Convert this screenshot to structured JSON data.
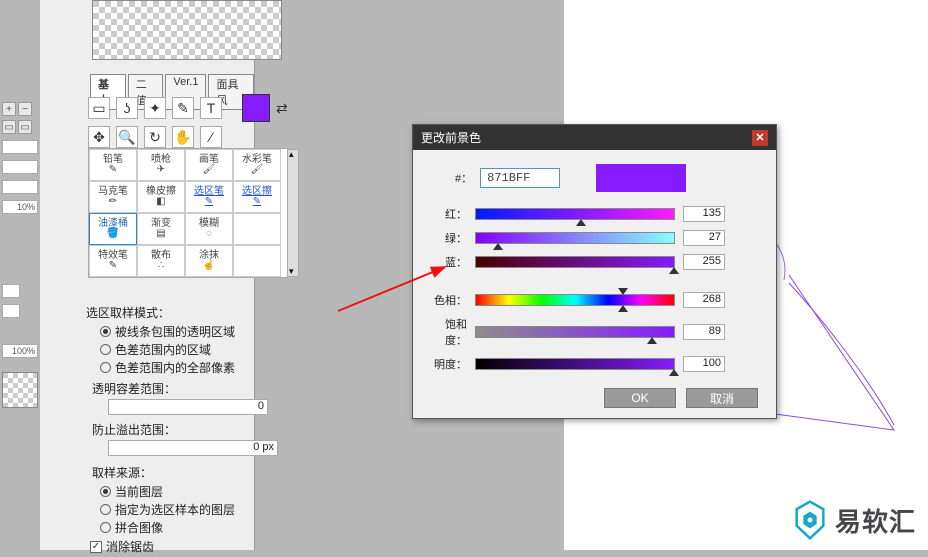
{
  "farLeft": {
    "pct": "10%",
    "zoom": "100%"
  },
  "tabs": {
    "basic": "基本",
    "binary": "二值",
    "ver": "Ver.1",
    "mask": "面具风"
  },
  "toolGrid": {
    "r1": [
      "铅笔",
      "喷枪",
      "画笔",
      "水彩笔"
    ],
    "r2": [
      "马克笔",
      "橡皮擦",
      "选区笔",
      "选区擦"
    ],
    "r3": [
      "油漆桶",
      "渐变",
      "模糊",
      ""
    ],
    "r4": [
      "特效笔",
      "散布",
      "涂抹",
      ""
    ]
  },
  "opts": {
    "modeLabel": "选区取样模式：",
    "r1": "被线条包围的透明区域",
    "r2": "色差范围内的区域",
    "r3": "色差范围内的全部像素",
    "tolLabel": "透明容差范围：",
    "tolVal": "0",
    "overflowLabel": "防止溢出范围：",
    "overflowVal": "0 px",
    "sourceLabel": "取样来源：",
    "s1": "当前图层",
    "s2": "指定为选区样本的图层",
    "s3": "拼合图像",
    "antialias": "消除锯齿"
  },
  "dialog": {
    "title": "更改前景色",
    "hashLabel": "#：",
    "hex": "871BFF",
    "labels": {
      "r": "红：",
      "g": "绿：",
      "b": "蓝：",
      "h": "色相：",
      "s": "饱和度：",
      "v": "明度："
    },
    "values": {
      "r": "135",
      "g": "27",
      "b": "255",
      "h": "268",
      "s": "89",
      "v": "100"
    },
    "ok": "OK",
    "cancel": "取消"
  },
  "watermark": "易软汇"
}
